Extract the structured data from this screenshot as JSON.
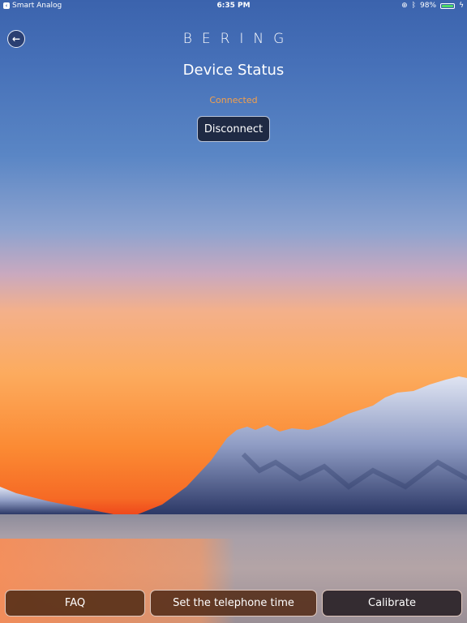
{
  "status_bar": {
    "back_app": "Smart Analog",
    "time": "6:35 PM",
    "battery": "98%",
    "battery_level": 0.98,
    "icons": [
      "lock-rotation-icon",
      "bluetooth-icon",
      "battery-icon",
      "charging-icon"
    ]
  },
  "header": {
    "back_icon": "arrow-left-icon",
    "logo": "BERING",
    "title": "Device Status"
  },
  "device": {
    "status": "Connected",
    "status_color": "#f4a04a",
    "disconnect_label": "Disconnect"
  },
  "bottom_bar": {
    "buttons": [
      {
        "label": "FAQ"
      },
      {
        "label": "Set the telephone time"
      },
      {
        "label": "Calibrate"
      }
    ]
  }
}
